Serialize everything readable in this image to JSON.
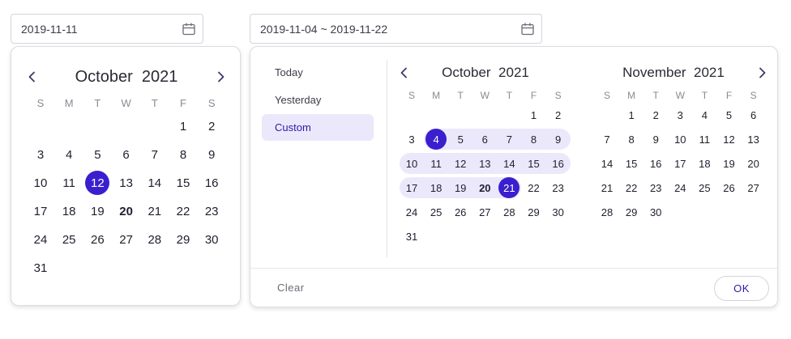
{
  "single": {
    "input_value": "2019-11-11",
    "icon": "calendar-icon",
    "calendar": {
      "month": "October",
      "year": "2021",
      "weekdays": [
        "S",
        "M",
        "T",
        "W",
        "T",
        "F",
        "S"
      ],
      "days": [
        [
          "",
          "",
          "",
          "",
          "",
          "1",
          "2"
        ],
        [
          "3",
          "4",
          "5",
          "6",
          "7",
          "8",
          "9"
        ],
        [
          "10",
          "11",
          "12",
          "13",
          "14",
          "15",
          "16"
        ],
        [
          "17",
          "18",
          "19",
          "20",
          "21",
          "22",
          "23"
        ],
        [
          "24",
          "25",
          "26",
          "27",
          "28",
          "29",
          "30"
        ],
        [
          "31",
          "",
          "",
          "",
          "",
          "",
          ""
        ]
      ],
      "selected_day": "12",
      "today_day": "20"
    }
  },
  "range": {
    "input_value": "2019-11-04 ~ 2019-11-22",
    "icon": "calendar-icon",
    "shortcuts": [
      "Today",
      "Yesterday",
      "Custom"
    ],
    "active_shortcut": "Custom",
    "left": {
      "month": "October",
      "year": "2021",
      "weekdays": [
        "S",
        "M",
        "T",
        "W",
        "T",
        "F",
        "S"
      ],
      "days": [
        [
          "",
          "",
          "",
          "",
          "",
          "1",
          "2"
        ],
        [
          "3",
          "4",
          "5",
          "6",
          "7",
          "8",
          "9"
        ],
        [
          "10",
          "11",
          "12",
          "13",
          "14",
          "15",
          "16"
        ],
        [
          "17",
          "18",
          "19",
          "20",
          "21",
          "22",
          "23"
        ],
        [
          "24",
          "25",
          "26",
          "27",
          "28",
          "29",
          "30"
        ],
        [
          "31",
          "",
          "",
          "",
          "",
          "",
          ""
        ]
      ],
      "range_start": "4",
      "range_end": "21",
      "today_day": "20"
    },
    "right": {
      "month": "November",
      "year": "2021",
      "weekdays": [
        "S",
        "M",
        "T",
        "W",
        "T",
        "F",
        "S"
      ],
      "days": [
        [
          "",
          "1",
          "2",
          "3",
          "4",
          "5",
          "6"
        ],
        [
          "7",
          "8",
          "9",
          "10",
          "11",
          "12",
          "13"
        ],
        [
          "14",
          "15",
          "16",
          "17",
          "18",
          "19",
          "20"
        ],
        [
          "21",
          "22",
          "23",
          "24",
          "25",
          "26",
          "27"
        ],
        [
          "28",
          "29",
          "30",
          "",
          "",
          "",
          ""
        ]
      ]
    },
    "clear_label": "Clear",
    "ok_label": "OK"
  },
  "colors": {
    "accent": "#3a1fcf",
    "range_fill": "#ece8fb"
  }
}
